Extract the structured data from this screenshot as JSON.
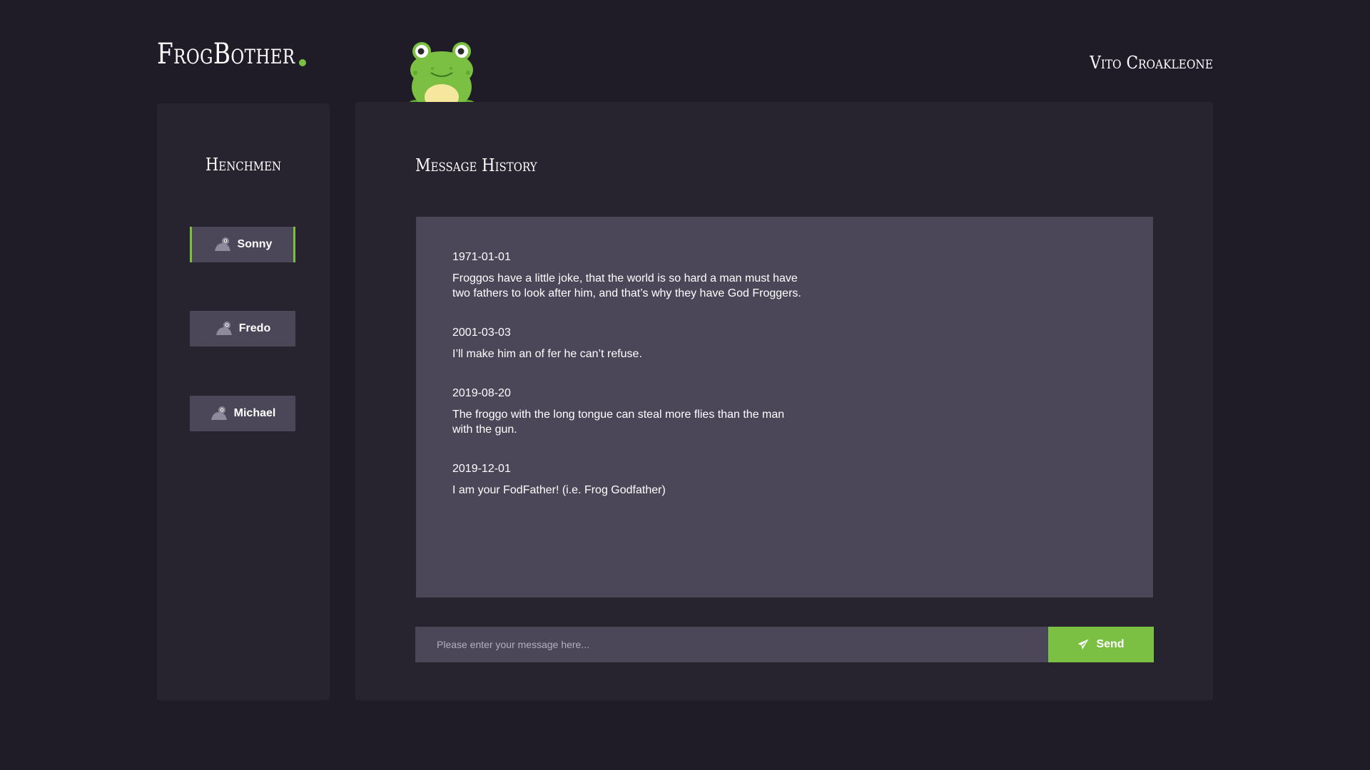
{
  "header": {
    "logo": "FrogBother",
    "user_name": "Vito Croakleone"
  },
  "sidebar": {
    "title": "Henchmen",
    "henchmen": [
      {
        "label": "Sonny",
        "icon": "frog-icon",
        "active": true
      },
      {
        "label": "Fredo",
        "icon": "frog-icon",
        "active": false
      },
      {
        "label": "Michael",
        "icon": "frog-icon",
        "active": false
      }
    ]
  },
  "main": {
    "title": "Message History",
    "messages": [
      {
        "date": "1971-01-01",
        "text": "Froggos have a little joke, that the world is so hard a man must have two fathers to look after him, and that’s why they have God Froggers."
      },
      {
        "date": "2001-03-03",
        "text": "I’ll make him an of fer he can’t refuse."
      },
      {
        "date": "2019-08-20",
        "text": "The froggo with the long tongue can steal more flies than the man with the gun."
      },
      {
        "date": "2019-12-01",
        "text": "I am your FodFather! (i.e. Frog Godfather)"
      }
    ],
    "composer": {
      "placeholder": "Please enter your message here...",
      "value": "",
      "send_label": "Send",
      "send_icon": "paper-plane-icon"
    }
  },
  "colors": {
    "background": "#1f1c28",
    "panel": "#27242f",
    "surface": "#4b4759",
    "accent": "#7bc043"
  }
}
